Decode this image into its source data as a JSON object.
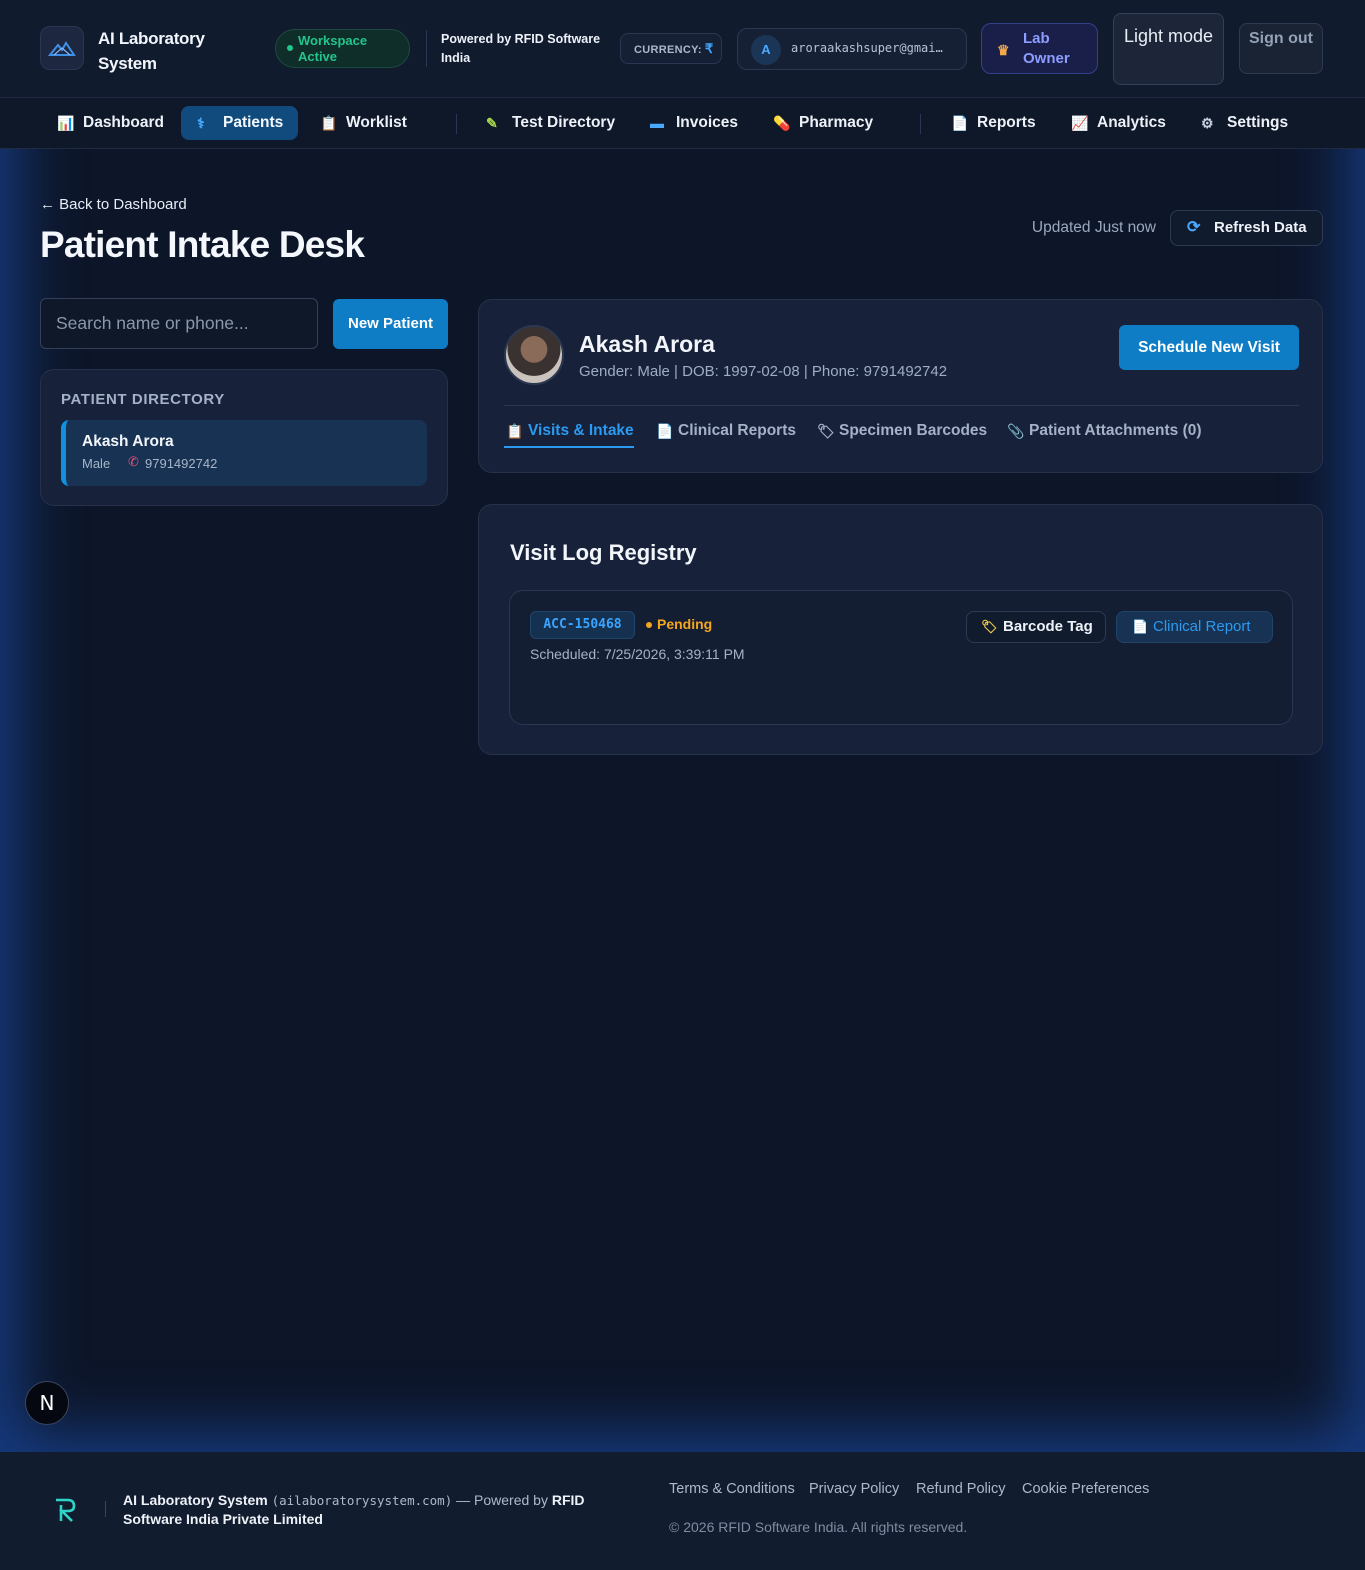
{
  "header": {
    "app_title": "AI Laboratory System",
    "workspace_status": "Workspace Active",
    "powered_by": "Powered by RFID Software India",
    "currency_label": "CURRENCY:",
    "currency_symbol": "₹",
    "user_initial": "A",
    "user_email": "aroraakashsuper@gmai…",
    "role_label": "Lab Owner",
    "theme_toggle_label": "Light mode",
    "signout_label": "Sign out"
  },
  "nav": {
    "items": [
      {
        "label": "Dashboard",
        "icon": "bar-chart-icon",
        "glyph": "📊"
      },
      {
        "label": "Patients",
        "icon": "stethoscope-icon",
        "glyph": "⚕"
      },
      {
        "label": "Worklist",
        "icon": "clipboard-icon",
        "glyph": "📋"
      },
      {
        "label": "Test Directory",
        "icon": "pipette-icon",
        "glyph": "✎"
      },
      {
        "label": "Invoices",
        "icon": "credit-card-icon",
        "glyph": "▬"
      },
      {
        "label": "Pharmacy",
        "icon": "pill-icon",
        "glyph": "💊"
      },
      {
        "label": "Reports",
        "icon": "report-icon",
        "glyph": "📄"
      },
      {
        "label": "Analytics",
        "icon": "trend-chart-icon",
        "glyph": "📈"
      },
      {
        "label": "Settings",
        "icon": "gear-icon",
        "glyph": "⚙"
      }
    ],
    "active": "Patients"
  },
  "page": {
    "back_link": "← Back to Dashboard",
    "title": "Patient Intake Desk",
    "updated_text": "Updated Just now",
    "refresh_label": "Refresh Data"
  },
  "search": {
    "placeholder": "Search name or phone...",
    "value": ""
  },
  "new_patient_label": "New Patient",
  "directory": {
    "heading": "PATIENT DIRECTORY",
    "patients": [
      {
        "name": "Akash Arora",
        "gender": "Male",
        "phone": "9791492742"
      }
    ]
  },
  "profile": {
    "name": "Akash Arora",
    "meta": "Gender: Male | DOB: 1997-02-08 | Phone: 9791492742",
    "schedule_label": "Schedule New Visit",
    "tabs": [
      {
        "label": "Visits & Intake",
        "icon": "clipboard-icon",
        "glyph": "📋"
      },
      {
        "label": "Clinical Reports",
        "icon": "document-icon",
        "glyph": "📄"
      },
      {
        "label": "Specimen Barcodes",
        "icon": "tag-icon",
        "glyph": "🏷"
      },
      {
        "label": "Patient Attachments (0)",
        "icon": "paperclip-icon",
        "glyph": "📎"
      }
    ],
    "active_tab": "Visits & Intake"
  },
  "visits": {
    "title": "Visit Log Registry",
    "rows": [
      {
        "accession": "ACC-150468",
        "status": "Pending",
        "scheduled": "Scheduled: 7/25/2026, 3:39:11 PM",
        "barcode_label": "Barcode Tag",
        "report_label": "Clinical Report"
      }
    ]
  },
  "floating_badge": "N",
  "footer": {
    "brand_name": "AI Laboratory System",
    "domain": "(ailaboratorysystem.com)",
    "powered_prefix": "— Powered by",
    "powered_company": "RFID Software India Private Limited",
    "links": [
      "Terms & Conditions",
      "Privacy Policy",
      "Refund Policy",
      "Cookie Preferences"
    ],
    "copyright": "© 2026 RFID Software India. All rights reserved."
  },
  "colors": {
    "accent": "#0e7dc6",
    "active_nav": "#114b7e",
    "pending": "#f4a620",
    "workspace_active": "#22c58b",
    "background": "#0d1629"
  }
}
